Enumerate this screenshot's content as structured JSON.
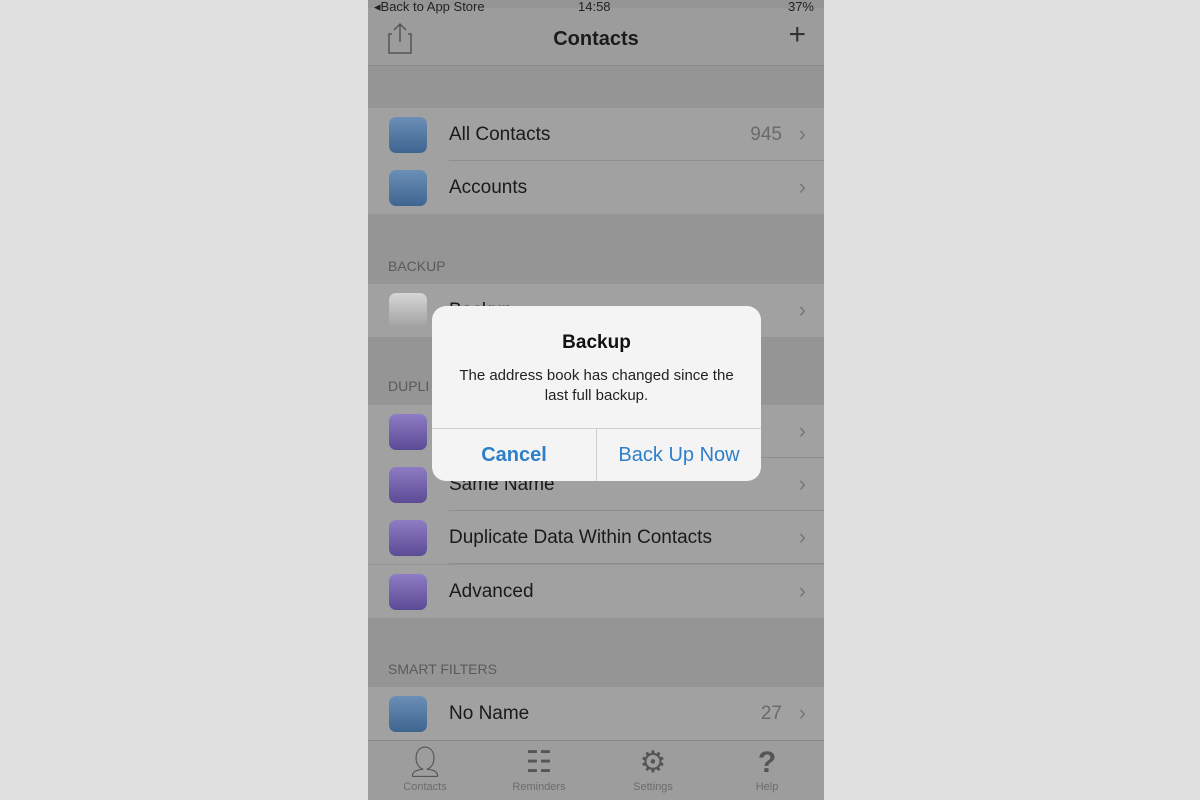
{
  "status_bar": {
    "back": "◂Back to App Store",
    "time": "14:58",
    "battery": "37%"
  },
  "nav": {
    "title": "Contacts",
    "add": "+"
  },
  "groups": [
    {
      "rows": [
        {
          "label": "All Contacts",
          "count": "945",
          "icon": "contacts-icon",
          "color": "blue"
        },
        {
          "label": "Accounts",
          "count": "",
          "icon": "accounts-icon",
          "color": "blue"
        }
      ]
    },
    {
      "header": "BACKUP",
      "rows": [
        {
          "label": "Backup",
          "count": "",
          "icon": "backup-icon",
          "color": "gray"
        }
      ]
    },
    {
      "header": "DUPLI",
      "rows": [
        {
          "label": "",
          "icon": "duplicate-contacts-icon"
        },
        {
          "label": "Same Name",
          "icon": "same-name-icon"
        },
        {
          "label": "Duplicate Data Within Contacts",
          "icon": "duplicate-data-icon"
        },
        {
          "label": "Advanced",
          "icon": "search-icon"
        }
      ]
    },
    {
      "header": "SMART FILTERS",
      "rows": [
        {
          "label": "No Name",
          "count": "27",
          "icon": "no-name-icon"
        }
      ]
    }
  ],
  "tabs": [
    {
      "label": "Contacts",
      "icon": "person-icon"
    },
    {
      "label": "Reminders",
      "icon": "list-icon"
    },
    {
      "label": "Settings",
      "icon": "gear-icon"
    },
    {
      "label": "Help",
      "icon": "question-icon"
    }
  ],
  "alert": {
    "title": "Backup",
    "message": "The address book has changed since the last full backup.",
    "cancel": "Cancel",
    "confirm": "Back Up Now"
  },
  "colors": {
    "accent": "#2e7fc9"
  }
}
